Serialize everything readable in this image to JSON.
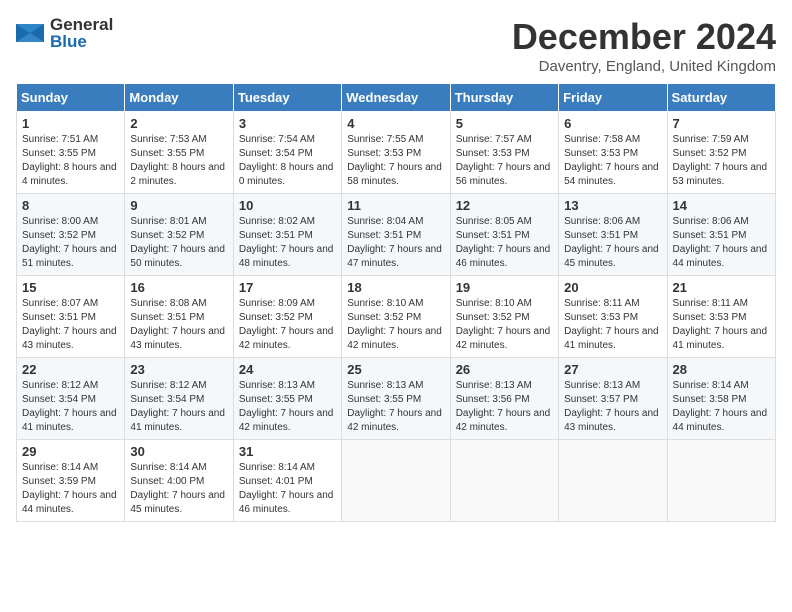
{
  "logo": {
    "general": "General",
    "blue": "Blue"
  },
  "title": "December 2024",
  "subtitle": "Daventry, England, United Kingdom",
  "headers": [
    "Sunday",
    "Monday",
    "Tuesday",
    "Wednesday",
    "Thursday",
    "Friday",
    "Saturday"
  ],
  "weeks": [
    [
      {
        "day": "1",
        "sunrise": "Sunrise: 7:51 AM",
        "sunset": "Sunset: 3:55 PM",
        "daylight": "Daylight: 8 hours and 4 minutes."
      },
      {
        "day": "2",
        "sunrise": "Sunrise: 7:53 AM",
        "sunset": "Sunset: 3:55 PM",
        "daylight": "Daylight: 8 hours and 2 minutes."
      },
      {
        "day": "3",
        "sunrise": "Sunrise: 7:54 AM",
        "sunset": "Sunset: 3:54 PM",
        "daylight": "Daylight: 8 hours and 0 minutes."
      },
      {
        "day": "4",
        "sunrise": "Sunrise: 7:55 AM",
        "sunset": "Sunset: 3:53 PM",
        "daylight": "Daylight: 7 hours and 58 minutes."
      },
      {
        "day": "5",
        "sunrise": "Sunrise: 7:57 AM",
        "sunset": "Sunset: 3:53 PM",
        "daylight": "Daylight: 7 hours and 56 minutes."
      },
      {
        "day": "6",
        "sunrise": "Sunrise: 7:58 AM",
        "sunset": "Sunset: 3:53 PM",
        "daylight": "Daylight: 7 hours and 54 minutes."
      },
      {
        "day": "7",
        "sunrise": "Sunrise: 7:59 AM",
        "sunset": "Sunset: 3:52 PM",
        "daylight": "Daylight: 7 hours and 53 minutes."
      }
    ],
    [
      {
        "day": "8",
        "sunrise": "Sunrise: 8:00 AM",
        "sunset": "Sunset: 3:52 PM",
        "daylight": "Daylight: 7 hours and 51 minutes."
      },
      {
        "day": "9",
        "sunrise": "Sunrise: 8:01 AM",
        "sunset": "Sunset: 3:52 PM",
        "daylight": "Daylight: 7 hours and 50 minutes."
      },
      {
        "day": "10",
        "sunrise": "Sunrise: 8:02 AM",
        "sunset": "Sunset: 3:51 PM",
        "daylight": "Daylight: 7 hours and 48 minutes."
      },
      {
        "day": "11",
        "sunrise": "Sunrise: 8:04 AM",
        "sunset": "Sunset: 3:51 PM",
        "daylight": "Daylight: 7 hours and 47 minutes."
      },
      {
        "day": "12",
        "sunrise": "Sunrise: 8:05 AM",
        "sunset": "Sunset: 3:51 PM",
        "daylight": "Daylight: 7 hours and 46 minutes."
      },
      {
        "day": "13",
        "sunrise": "Sunrise: 8:06 AM",
        "sunset": "Sunset: 3:51 PM",
        "daylight": "Daylight: 7 hours and 45 minutes."
      },
      {
        "day": "14",
        "sunrise": "Sunrise: 8:06 AM",
        "sunset": "Sunset: 3:51 PM",
        "daylight": "Daylight: 7 hours and 44 minutes."
      }
    ],
    [
      {
        "day": "15",
        "sunrise": "Sunrise: 8:07 AM",
        "sunset": "Sunset: 3:51 PM",
        "daylight": "Daylight: 7 hours and 43 minutes."
      },
      {
        "day": "16",
        "sunrise": "Sunrise: 8:08 AM",
        "sunset": "Sunset: 3:51 PM",
        "daylight": "Daylight: 7 hours and 43 minutes."
      },
      {
        "day": "17",
        "sunrise": "Sunrise: 8:09 AM",
        "sunset": "Sunset: 3:52 PM",
        "daylight": "Daylight: 7 hours and 42 minutes."
      },
      {
        "day": "18",
        "sunrise": "Sunrise: 8:10 AM",
        "sunset": "Sunset: 3:52 PM",
        "daylight": "Daylight: 7 hours and 42 minutes."
      },
      {
        "day": "19",
        "sunrise": "Sunrise: 8:10 AM",
        "sunset": "Sunset: 3:52 PM",
        "daylight": "Daylight: 7 hours and 42 minutes."
      },
      {
        "day": "20",
        "sunrise": "Sunrise: 8:11 AM",
        "sunset": "Sunset: 3:53 PM",
        "daylight": "Daylight: 7 hours and 41 minutes."
      },
      {
        "day": "21",
        "sunrise": "Sunrise: 8:11 AM",
        "sunset": "Sunset: 3:53 PM",
        "daylight": "Daylight: 7 hours and 41 minutes."
      }
    ],
    [
      {
        "day": "22",
        "sunrise": "Sunrise: 8:12 AM",
        "sunset": "Sunset: 3:54 PM",
        "daylight": "Daylight: 7 hours and 41 minutes."
      },
      {
        "day": "23",
        "sunrise": "Sunrise: 8:12 AM",
        "sunset": "Sunset: 3:54 PM",
        "daylight": "Daylight: 7 hours and 41 minutes."
      },
      {
        "day": "24",
        "sunrise": "Sunrise: 8:13 AM",
        "sunset": "Sunset: 3:55 PM",
        "daylight": "Daylight: 7 hours and 42 minutes."
      },
      {
        "day": "25",
        "sunrise": "Sunrise: 8:13 AM",
        "sunset": "Sunset: 3:55 PM",
        "daylight": "Daylight: 7 hours and 42 minutes."
      },
      {
        "day": "26",
        "sunrise": "Sunrise: 8:13 AM",
        "sunset": "Sunset: 3:56 PM",
        "daylight": "Daylight: 7 hours and 42 minutes."
      },
      {
        "day": "27",
        "sunrise": "Sunrise: 8:13 AM",
        "sunset": "Sunset: 3:57 PM",
        "daylight": "Daylight: 7 hours and 43 minutes."
      },
      {
        "day": "28",
        "sunrise": "Sunrise: 8:14 AM",
        "sunset": "Sunset: 3:58 PM",
        "daylight": "Daylight: 7 hours and 44 minutes."
      }
    ],
    [
      {
        "day": "29",
        "sunrise": "Sunrise: 8:14 AM",
        "sunset": "Sunset: 3:59 PM",
        "daylight": "Daylight: 7 hours and 44 minutes."
      },
      {
        "day": "30",
        "sunrise": "Sunrise: 8:14 AM",
        "sunset": "Sunset: 4:00 PM",
        "daylight": "Daylight: 7 hours and 45 minutes."
      },
      {
        "day": "31",
        "sunrise": "Sunrise: 8:14 AM",
        "sunset": "Sunset: 4:01 PM",
        "daylight": "Daylight: 7 hours and 46 minutes."
      },
      null,
      null,
      null,
      null
    ]
  ]
}
